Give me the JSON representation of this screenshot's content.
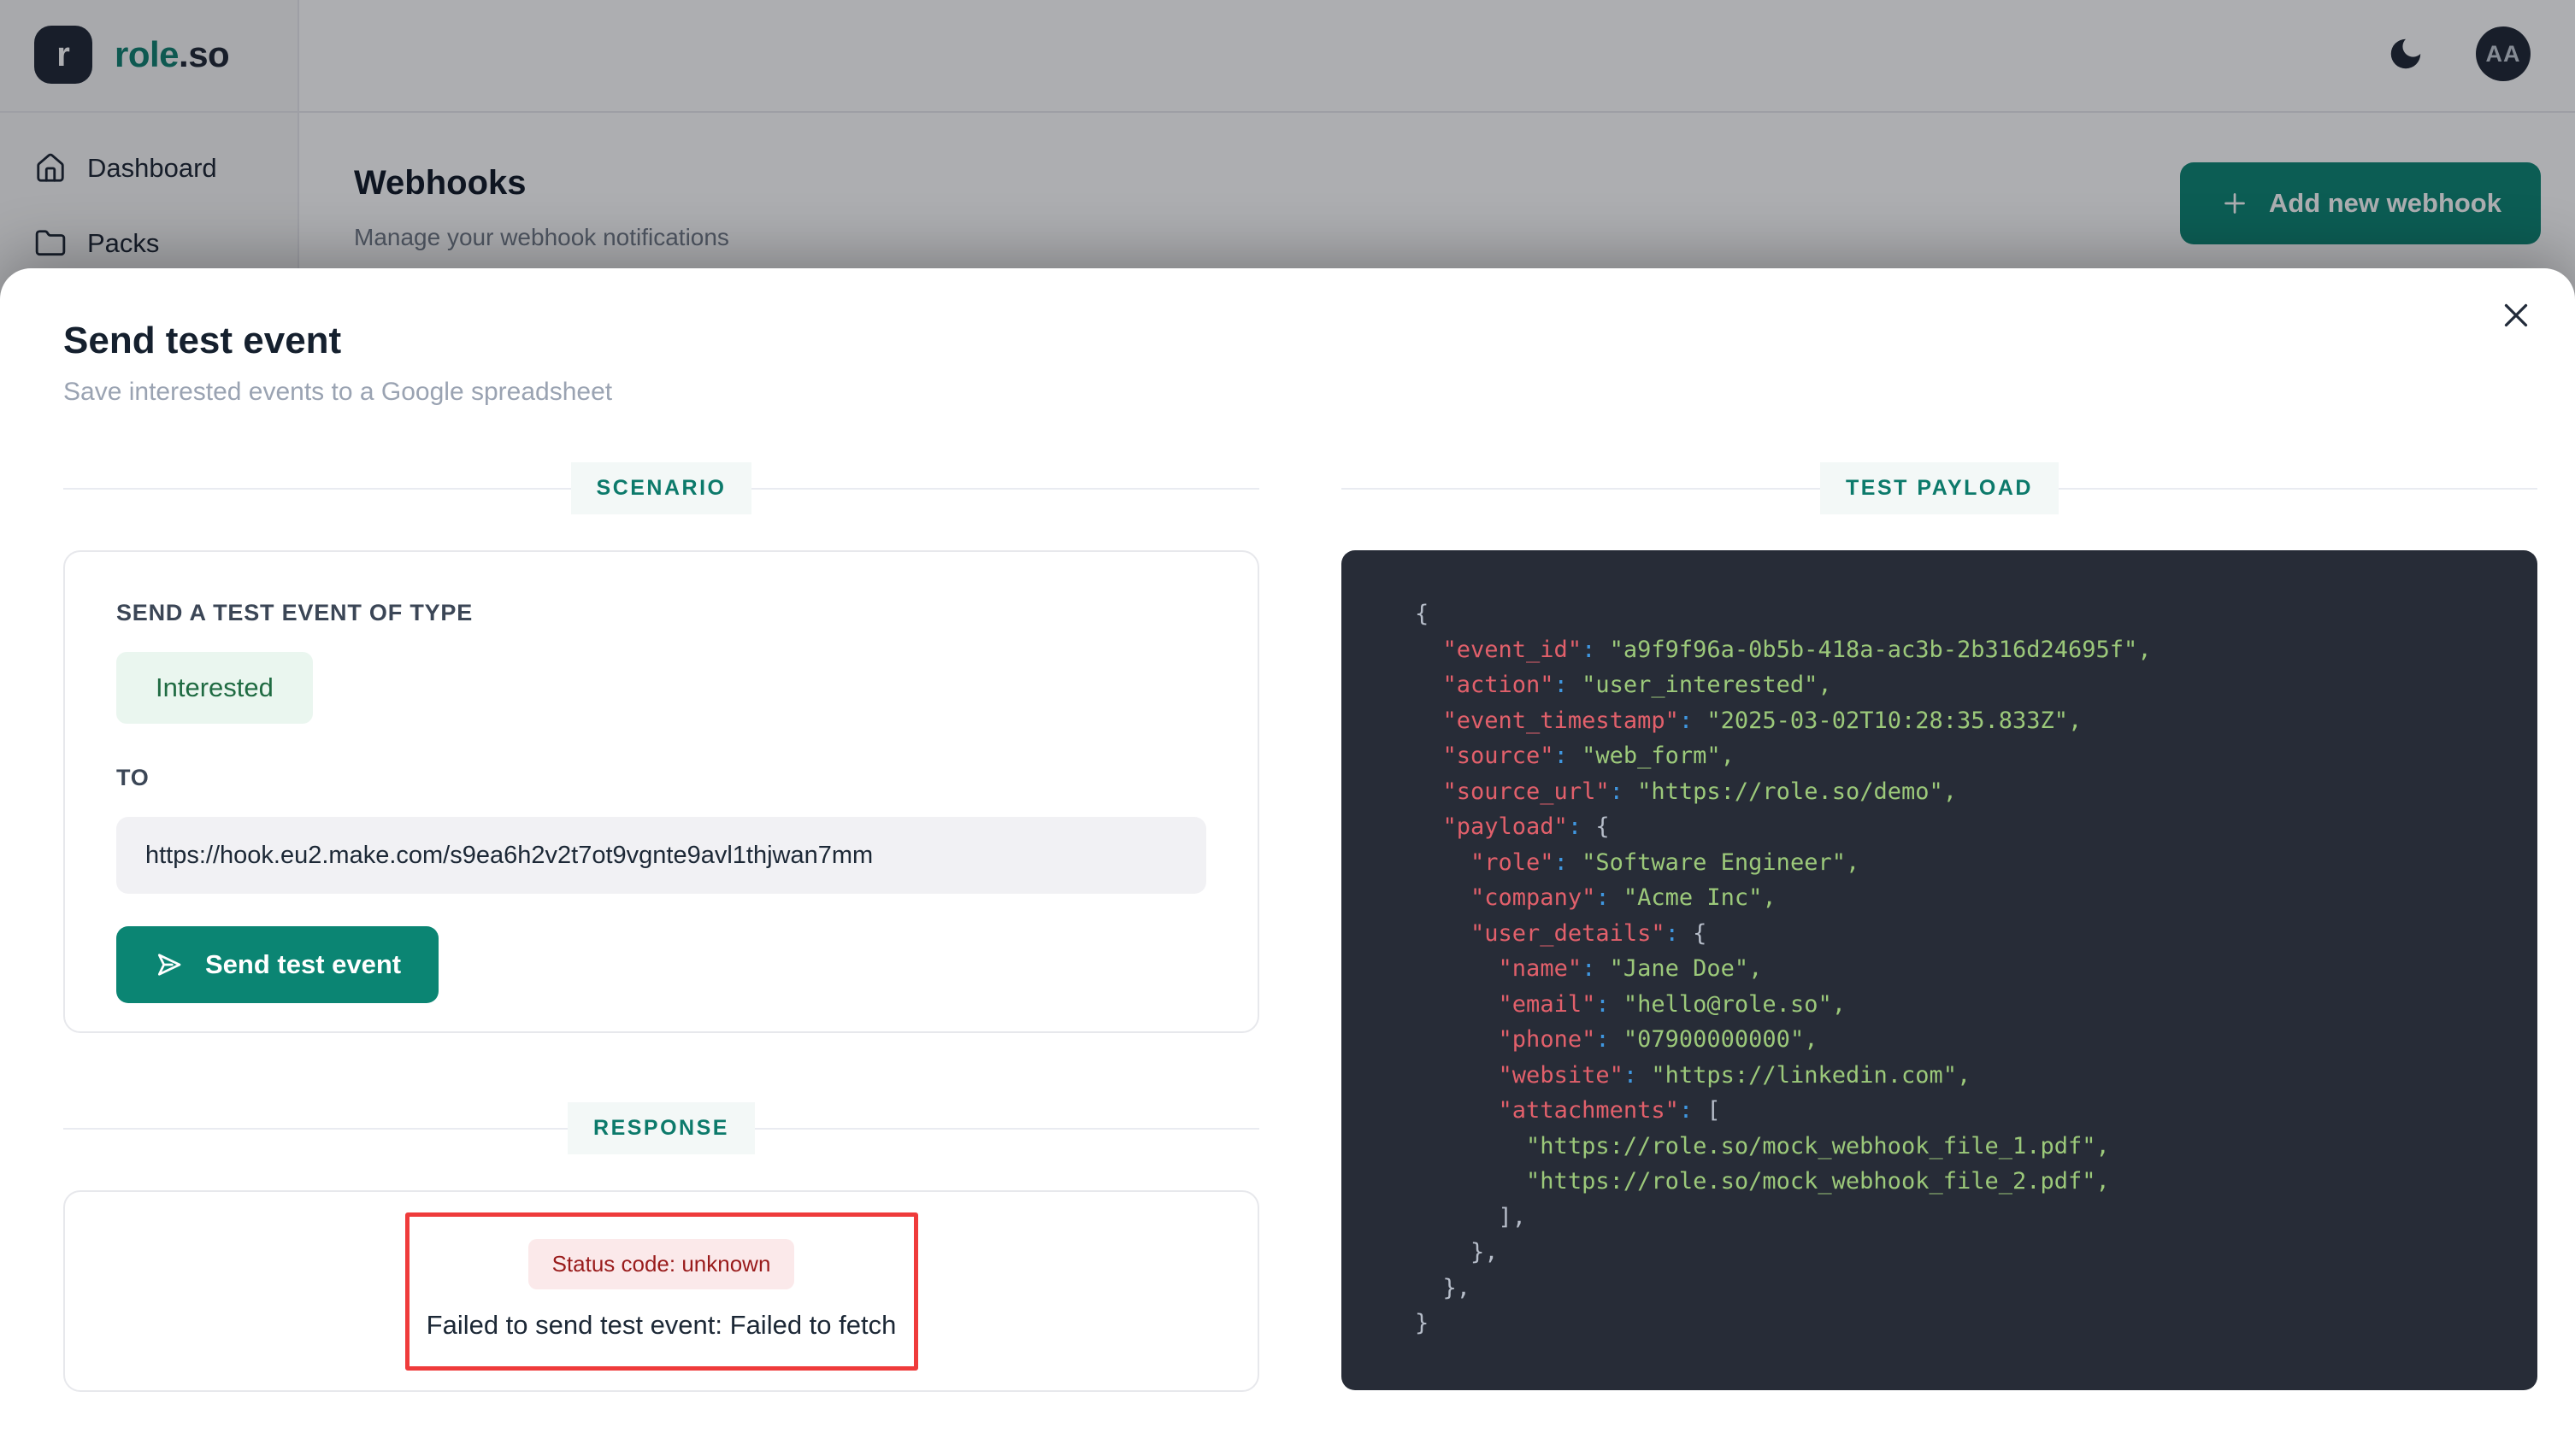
{
  "brand": {
    "logo_letter": "r",
    "name_primary": "role",
    "name_suffix": ".so"
  },
  "topbar": {
    "avatar_initials": "AA"
  },
  "sidebar": {
    "items": [
      {
        "label": "Dashboard",
        "icon": "home-icon"
      },
      {
        "label": "Packs",
        "icon": "folder-icon"
      }
    ]
  },
  "page_header": {
    "title": "Webhooks",
    "subtitle": "Manage your webhook notifications",
    "add_button_label": "Add new webhook"
  },
  "modal": {
    "title": "Send test event",
    "subtitle": "Save interested events to a Google spreadsheet",
    "scenario_section_label": "SCENARIO",
    "response_section_label": "RESPONSE",
    "payload_section_label": "TEST PAYLOAD",
    "scenario": {
      "event_type_label": "SEND A TEST EVENT OF TYPE",
      "event_type_value": "Interested",
      "to_label": "TO",
      "webhook_url": "https://hook.eu2.make.com/s9ea6h2v2t7ot9vgnte9avl1thjwan7mm",
      "send_button_label": "Send test event"
    },
    "response": {
      "status_badge": "Status code: unknown",
      "error_message": "Failed to send test event: Failed to fetch"
    },
    "payload_code": {
      "lines": [
        "{",
        "  \"event_id\": \"a9f9f96a-0b5b-418a-ac3b-2b316d24695f\",",
        "  \"action\": \"user_interested\",",
        "  \"event_timestamp\": \"2025-03-02T10:28:35.833Z\",",
        "  \"source\": \"web_form\",",
        "  \"source_url\": \"https://role.so/demo\",",
        "  \"payload\": {",
        "    \"role\": \"Software Engineer\",",
        "    \"company\": \"Acme Inc\",",
        "    \"user_details\": {",
        "      \"name\": \"Jane Doe\",",
        "      \"email\": \"hello@role.so\",",
        "      \"phone\": \"07900000000\",",
        "      \"website\": \"https://linkedin.com\",",
        "      \"attachments\": [",
        "        \"https://role.so/mock_webhook_file_1.pdf\",",
        "        \"https://role.so/mock_webhook_file_2.pdf\",",
        "      ],",
        "    },",
        "  },",
        "}"
      ]
    }
  },
  "colors": {
    "accent": "#0b8573",
    "accent-dark": "#0c7a6b",
    "code-bg": "#272c37",
    "code-key": "#e2606b",
    "code-colon": "#3f97e0",
    "code-str": "#9cc97a",
    "code-pun": "#b6bdc9",
    "err-border": "#ef3b3b",
    "err-badge-bg": "#fbe9ea",
    "err-badge-text": "#991b1b",
    "chip-bg": "#eaf6ef",
    "chip-text": "#1f6b42"
  }
}
